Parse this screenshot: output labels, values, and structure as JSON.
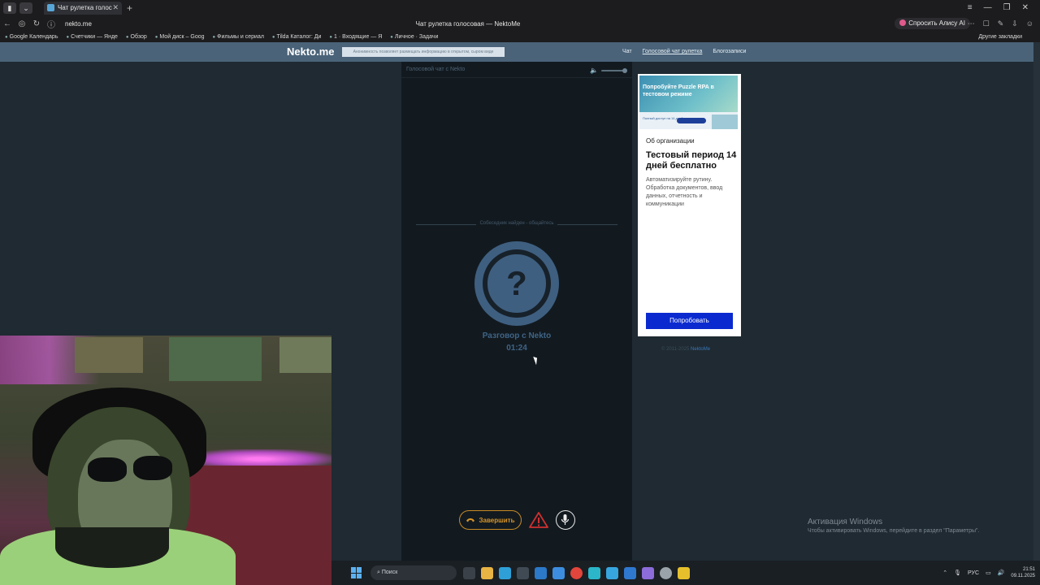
{
  "browser": {
    "tab_title": "Чат рулетка голосовая",
    "window_title": "Чат рулетка голосовая — NektoMe",
    "url": "nekto.me",
    "alice_label": "Спросить Алису AI",
    "bookmarks": [
      "Google Календарь",
      "Счетчики — Янде",
      "Обзор",
      "Мой диск – Goog",
      "Фильмы и сериал",
      "Tilda Каталог: Ди",
      "1 · Входящие — Я",
      "Личное · Задачи"
    ],
    "other_bookmarks": "Другие закладки"
  },
  "site": {
    "logo": "Nekto.me",
    "notice": "Анонимность позволяет размещать информацию в открытом, сыром виде",
    "nav": [
      "Чат",
      "Голосовой чат рулетка",
      "Блогозаписи"
    ]
  },
  "call": {
    "header": "Голосовой чат с Nekto",
    "divider": "Собеседник найден - общайтесь",
    "avatar_symbol": "?",
    "conversation_label": "Разговор с Nekto",
    "timer": "01:24",
    "end_label": "Завершить"
  },
  "ad": {
    "banner_title": "Попробуйте Puzzle RPA в тестовом режиме",
    "banner_sub": "Полный доступ на 14 дней",
    "org": "Об организации",
    "title": "Тестовый период 14 дней бесплатно",
    "text": "Автоматизируйте рутину. Обработка документов, ввод данных, отчетность и коммуникации",
    "button": "Попробовать"
  },
  "footer": {
    "copyright": "© 2011-2025",
    "link": "NektoMe"
  },
  "windows": {
    "activation_title": "Активация Windows",
    "activation_text": "Чтобы активировать Windows, перейдите в раздел \"Параметры\".",
    "search": "Поиск",
    "lang": "РУС",
    "time": "21:51",
    "date": "09.11.2025"
  },
  "colors": {
    "site_header": "#4a6379",
    "panel": "#121a20",
    "accent_end": "#d79528",
    "warn": "#d03030",
    "ad_button": "#0a2ad0"
  }
}
